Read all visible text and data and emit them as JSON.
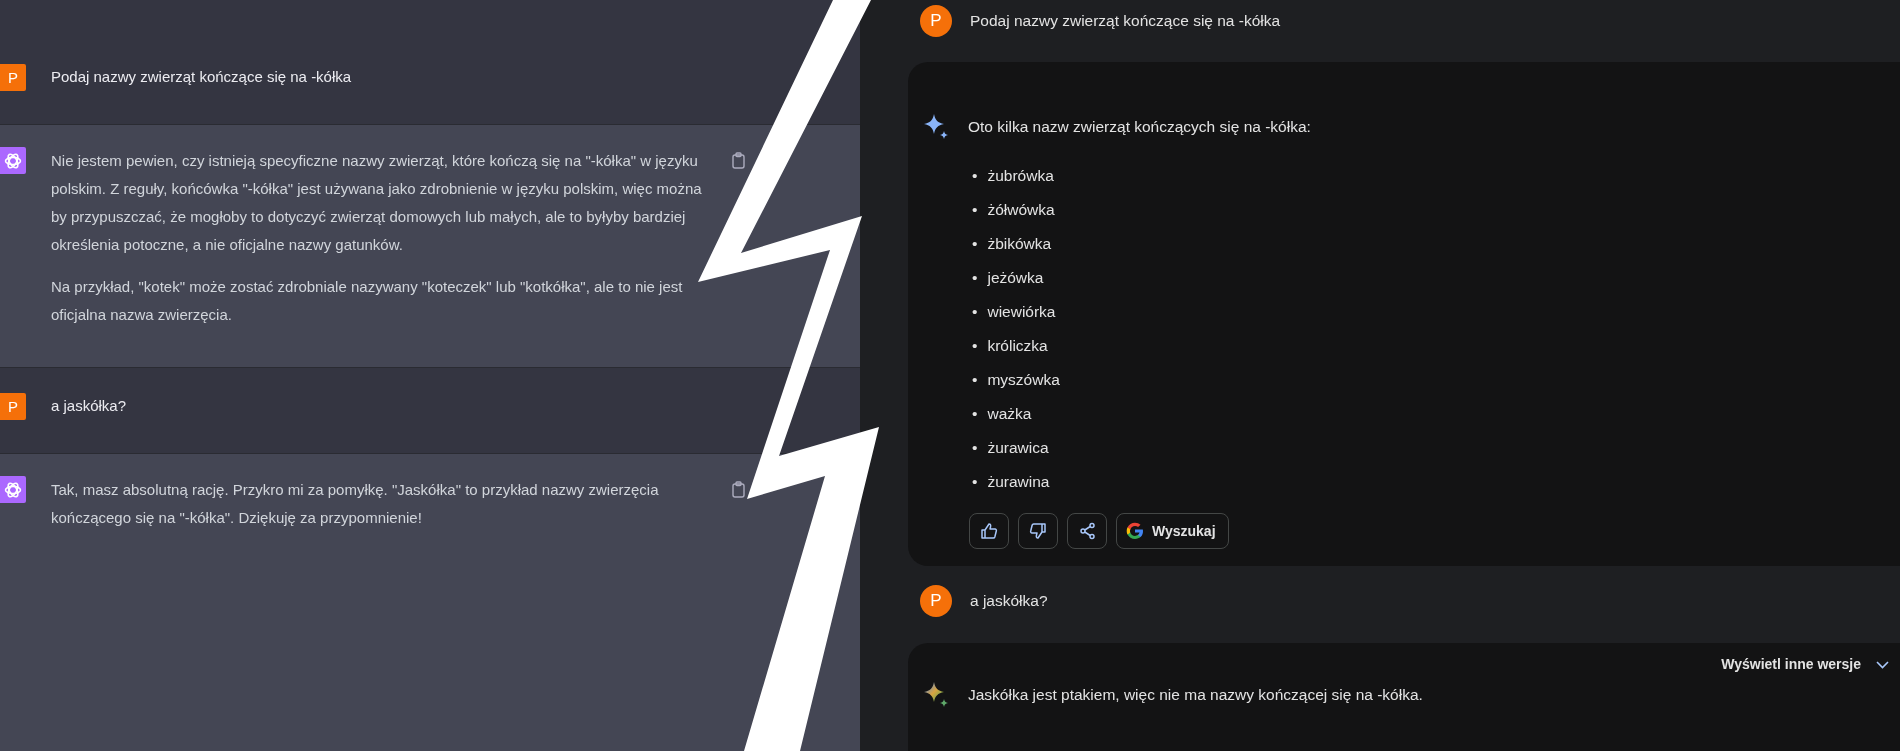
{
  "left_chat": {
    "messages": [
      {
        "kind": "user",
        "avatar": "P",
        "paragraphs": [
          "Podaj nazwy zwierząt kończące się na -kółka"
        ]
      },
      {
        "kind": "assistant",
        "paragraphs": [
          "Nie jestem pewien, czy istnieją specyficzne nazwy zwierząt, które kończą się na \"-kółka\" w języku polskim. Z reguły, końcówka \"-kółka\" jest używana jako zdrobnienie w języku polskim, więc można by przypuszczać, że mogłoby to dotyczyć zwierząt domowych lub małych, ale to byłyby bardziej określenia potoczne, a nie oficjalne nazwy gatunków.",
          "Na przykład, \"kotek\" może zostać zdrobniale nazywany \"koteczek\" lub \"kotkółka\", ale to nie jest oficjalna nazwa zwierzęcia."
        ]
      },
      {
        "kind": "user",
        "avatar": "P",
        "paragraphs": [
          "a jaskółka?"
        ]
      },
      {
        "kind": "assistant",
        "paragraphs": [
          "Tak, masz absolutną rację. Przykro mi za pomyłkę. \"Jaskółka\" to przykład nazwy zwierzęcia kończącego się na \"-kółka\". Dziękuję za przypomnienie!"
        ]
      }
    ]
  },
  "right_chat": {
    "messages": [
      {
        "kind": "user",
        "avatar": "P",
        "text": "Podaj nazwy zwierząt kończące się na -kółka"
      },
      {
        "kind": "assistant",
        "text": "Oto kilka nazw zwierząt kończących się na -kółka:",
        "list": [
          {
            "bullet": "•",
            "text": "żubrówka"
          },
          {
            "bullet": "•",
            "text": "żółwówka"
          },
          {
            "bullet": "•",
            "text": "żbikówka"
          },
          {
            "bullet": "•",
            "text": "jeżówka"
          },
          {
            "bullet": "•",
            "text": "wiewiórka"
          },
          {
            "bullet": "•",
            "text": "króliczka"
          },
          {
            "bullet": "•",
            "text": "myszówka"
          },
          {
            "bullet": "•",
            "text": "ważka"
          },
          {
            "bullet": "•",
            "text": "żurawica"
          },
          {
            "bullet": "•",
            "text": "żurawina"
          }
        ],
        "search_label": "Wyszukaj"
      },
      {
        "kind": "user",
        "avatar": "P",
        "text": "a jaskółka?"
      },
      {
        "kind": "assistant",
        "versions_label": "Wyświetl inne wersje",
        "text": "Jaskółka jest ptakiem, więc nie ma nazwy kończącej się na -kółka."
      }
    ]
  }
}
